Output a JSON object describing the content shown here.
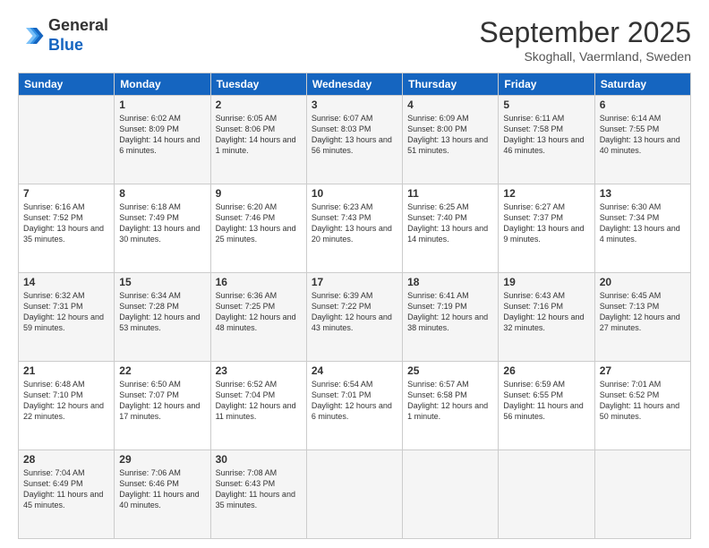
{
  "logo": {
    "general": "General",
    "blue": "Blue"
  },
  "header": {
    "month": "September 2025",
    "location": "Skoghall, Vaermland, Sweden"
  },
  "days": [
    "Sunday",
    "Monday",
    "Tuesday",
    "Wednesday",
    "Thursday",
    "Friday",
    "Saturday"
  ],
  "weeks": [
    [
      {
        "day": "",
        "sunrise": "",
        "sunset": "",
        "daylight": ""
      },
      {
        "day": "1",
        "sunrise": "Sunrise: 6:02 AM",
        "sunset": "Sunset: 8:09 PM",
        "daylight": "Daylight: 14 hours and 6 minutes."
      },
      {
        "day": "2",
        "sunrise": "Sunrise: 6:05 AM",
        "sunset": "Sunset: 8:06 PM",
        "daylight": "Daylight: 14 hours and 1 minute."
      },
      {
        "day": "3",
        "sunrise": "Sunrise: 6:07 AM",
        "sunset": "Sunset: 8:03 PM",
        "daylight": "Daylight: 13 hours and 56 minutes."
      },
      {
        "day": "4",
        "sunrise": "Sunrise: 6:09 AM",
        "sunset": "Sunset: 8:00 PM",
        "daylight": "Daylight: 13 hours and 51 minutes."
      },
      {
        "day": "5",
        "sunrise": "Sunrise: 6:11 AM",
        "sunset": "Sunset: 7:58 PM",
        "daylight": "Daylight: 13 hours and 46 minutes."
      },
      {
        "day": "6",
        "sunrise": "Sunrise: 6:14 AM",
        "sunset": "Sunset: 7:55 PM",
        "daylight": "Daylight: 13 hours and 40 minutes."
      }
    ],
    [
      {
        "day": "7",
        "sunrise": "Sunrise: 6:16 AM",
        "sunset": "Sunset: 7:52 PM",
        "daylight": "Daylight: 13 hours and 35 minutes."
      },
      {
        "day": "8",
        "sunrise": "Sunrise: 6:18 AM",
        "sunset": "Sunset: 7:49 PM",
        "daylight": "Daylight: 13 hours and 30 minutes."
      },
      {
        "day": "9",
        "sunrise": "Sunrise: 6:20 AM",
        "sunset": "Sunset: 7:46 PM",
        "daylight": "Daylight: 13 hours and 25 minutes."
      },
      {
        "day": "10",
        "sunrise": "Sunrise: 6:23 AM",
        "sunset": "Sunset: 7:43 PM",
        "daylight": "Daylight: 13 hours and 20 minutes."
      },
      {
        "day": "11",
        "sunrise": "Sunrise: 6:25 AM",
        "sunset": "Sunset: 7:40 PM",
        "daylight": "Daylight: 13 hours and 14 minutes."
      },
      {
        "day": "12",
        "sunrise": "Sunrise: 6:27 AM",
        "sunset": "Sunset: 7:37 PM",
        "daylight": "Daylight: 13 hours and 9 minutes."
      },
      {
        "day": "13",
        "sunrise": "Sunrise: 6:30 AM",
        "sunset": "Sunset: 7:34 PM",
        "daylight": "Daylight: 13 hours and 4 minutes."
      }
    ],
    [
      {
        "day": "14",
        "sunrise": "Sunrise: 6:32 AM",
        "sunset": "Sunset: 7:31 PM",
        "daylight": "Daylight: 12 hours and 59 minutes."
      },
      {
        "day": "15",
        "sunrise": "Sunrise: 6:34 AM",
        "sunset": "Sunset: 7:28 PM",
        "daylight": "Daylight: 12 hours and 53 minutes."
      },
      {
        "day": "16",
        "sunrise": "Sunrise: 6:36 AM",
        "sunset": "Sunset: 7:25 PM",
        "daylight": "Daylight: 12 hours and 48 minutes."
      },
      {
        "day": "17",
        "sunrise": "Sunrise: 6:39 AM",
        "sunset": "Sunset: 7:22 PM",
        "daylight": "Daylight: 12 hours and 43 minutes."
      },
      {
        "day": "18",
        "sunrise": "Sunrise: 6:41 AM",
        "sunset": "Sunset: 7:19 PM",
        "daylight": "Daylight: 12 hours and 38 minutes."
      },
      {
        "day": "19",
        "sunrise": "Sunrise: 6:43 AM",
        "sunset": "Sunset: 7:16 PM",
        "daylight": "Daylight: 12 hours and 32 minutes."
      },
      {
        "day": "20",
        "sunrise": "Sunrise: 6:45 AM",
        "sunset": "Sunset: 7:13 PM",
        "daylight": "Daylight: 12 hours and 27 minutes."
      }
    ],
    [
      {
        "day": "21",
        "sunrise": "Sunrise: 6:48 AM",
        "sunset": "Sunset: 7:10 PM",
        "daylight": "Daylight: 12 hours and 22 minutes."
      },
      {
        "day": "22",
        "sunrise": "Sunrise: 6:50 AM",
        "sunset": "Sunset: 7:07 PM",
        "daylight": "Daylight: 12 hours and 17 minutes."
      },
      {
        "day": "23",
        "sunrise": "Sunrise: 6:52 AM",
        "sunset": "Sunset: 7:04 PM",
        "daylight": "Daylight: 12 hours and 11 minutes."
      },
      {
        "day": "24",
        "sunrise": "Sunrise: 6:54 AM",
        "sunset": "Sunset: 7:01 PM",
        "daylight": "Daylight: 12 hours and 6 minutes."
      },
      {
        "day": "25",
        "sunrise": "Sunrise: 6:57 AM",
        "sunset": "Sunset: 6:58 PM",
        "daylight": "Daylight: 12 hours and 1 minute."
      },
      {
        "day": "26",
        "sunrise": "Sunrise: 6:59 AM",
        "sunset": "Sunset: 6:55 PM",
        "daylight": "Daylight: 11 hours and 56 minutes."
      },
      {
        "day": "27",
        "sunrise": "Sunrise: 7:01 AM",
        "sunset": "Sunset: 6:52 PM",
        "daylight": "Daylight: 11 hours and 50 minutes."
      }
    ],
    [
      {
        "day": "28",
        "sunrise": "Sunrise: 7:04 AM",
        "sunset": "Sunset: 6:49 PM",
        "daylight": "Daylight: 11 hours and 45 minutes."
      },
      {
        "day": "29",
        "sunrise": "Sunrise: 7:06 AM",
        "sunset": "Sunset: 6:46 PM",
        "daylight": "Daylight: 11 hours and 40 minutes."
      },
      {
        "day": "30",
        "sunrise": "Sunrise: 7:08 AM",
        "sunset": "Sunset: 6:43 PM",
        "daylight": "Daylight: 11 hours and 35 minutes."
      },
      {
        "day": "",
        "sunrise": "",
        "sunset": "",
        "daylight": ""
      },
      {
        "day": "",
        "sunrise": "",
        "sunset": "",
        "daylight": ""
      },
      {
        "day": "",
        "sunrise": "",
        "sunset": "",
        "daylight": ""
      },
      {
        "day": "",
        "sunrise": "",
        "sunset": "",
        "daylight": ""
      }
    ]
  ]
}
